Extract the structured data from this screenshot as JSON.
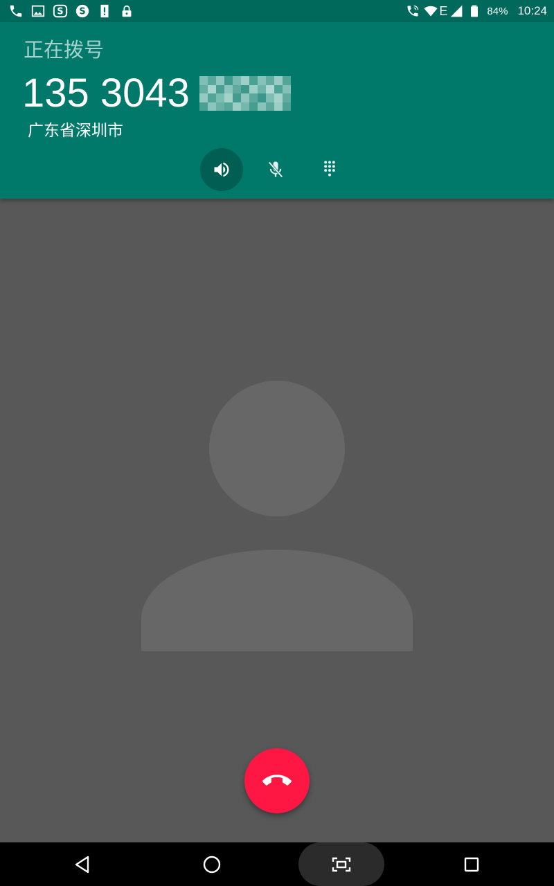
{
  "status_bar": {
    "left_icons": [
      "phone-icon",
      "image-icon",
      "s-app-icon",
      "s-circle-app-icon",
      "alert-icon",
      "lock-icon"
    ],
    "right_icons": [
      "wifi-calling-icon",
      "wifi-icon",
      "signal-icon",
      "battery-icon"
    ],
    "network_type": "E",
    "battery_percent": "84%",
    "time": "10:24"
  },
  "call": {
    "state_label": "正在拨号",
    "number_visible": "135 3043",
    "location": "广东省深圳市",
    "controls": [
      {
        "icon": "speaker-icon",
        "active": true
      },
      {
        "icon": "mute-icon",
        "active": false
      },
      {
        "icon": "dialpad-icon",
        "active": false
      }
    ]
  },
  "colors": {
    "status_bar": "#00695c",
    "header": "#00796b",
    "background": "#585858",
    "avatar": "#676767",
    "end_call": "#ff1744",
    "nav_bar": "#000000"
  },
  "nav": {
    "buttons": [
      "back-icon",
      "home-icon",
      "screenshot-icon",
      "recents-icon"
    ]
  }
}
